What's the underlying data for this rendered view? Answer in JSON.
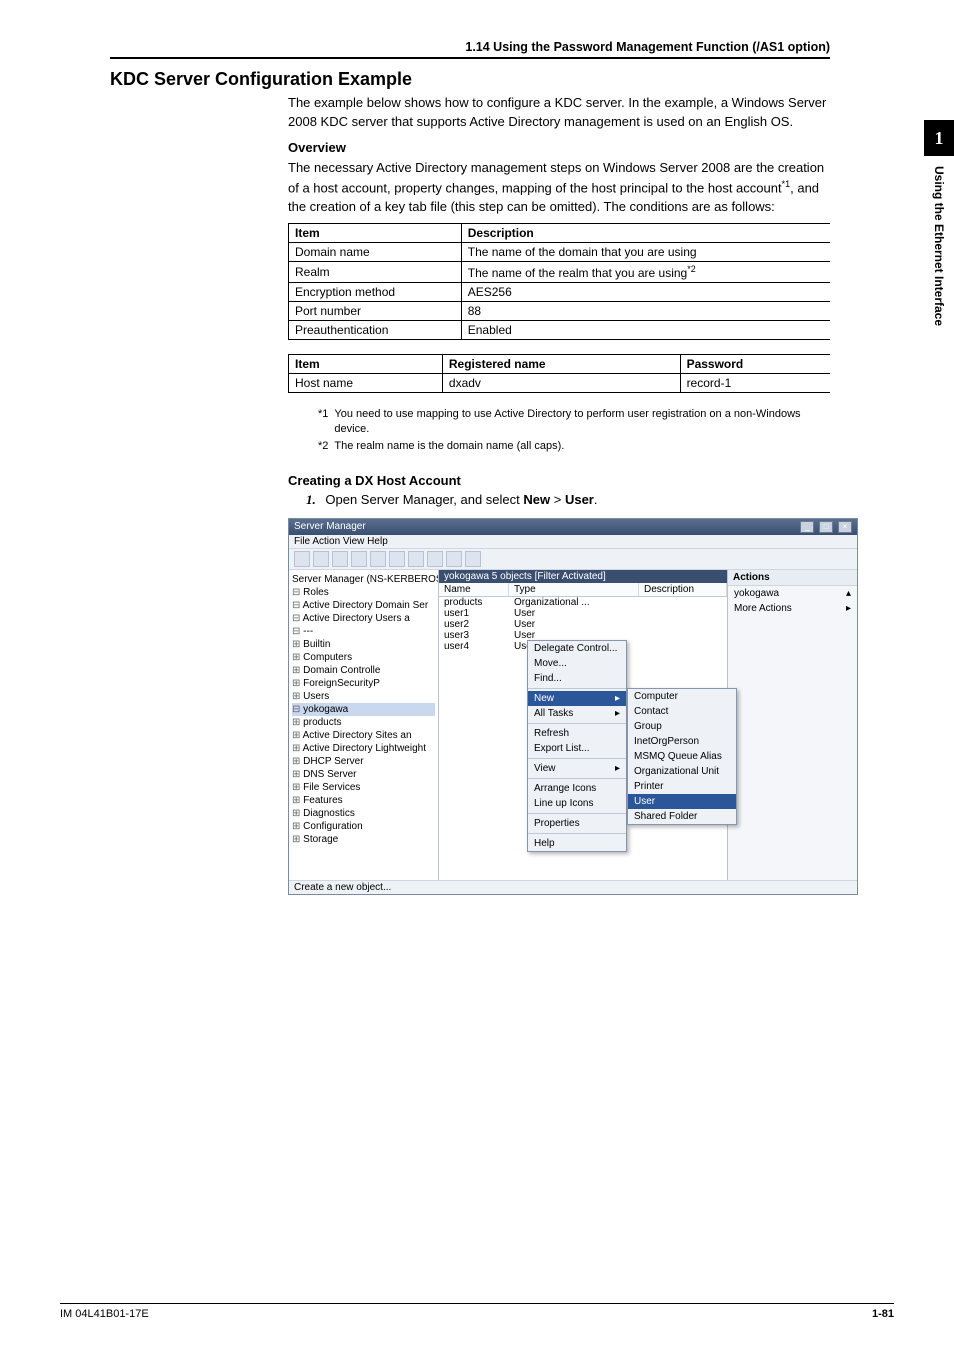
{
  "side": {
    "index": "1",
    "label": "Using the Ethernet Interface"
  },
  "breadcrumb": "1.14  Using the Password Management Function (/AS1 option)",
  "h1": "KDC Server Configuration Example",
  "intro": "The example below shows how to configure a KDC server. In the example, a Windows Server 2008 KDC server that supports Active Directory management is used on an English OS.",
  "overview_h": "Overview",
  "overview_p": "The necessary Active Directory management steps on Windows Server 2008 are the creation of a host account, property changes, mapping of the host principal to the host account",
  "overview_p_tail": ", and the creation of a key tab file (this step can be omitted). The conditions are as follows:",
  "overview_sup": "*1",
  "table1": {
    "head": [
      "Item",
      "Description"
    ],
    "rows": [
      [
        "Domain name",
        "The name of the domain that you are using"
      ],
      [
        "Realm",
        "The name of the realm that you are using"
      ],
      [
        "Encryption method",
        "AES256"
      ],
      [
        "Port number",
        "88"
      ],
      [
        "Preauthentication",
        "Enabled"
      ]
    ],
    "row2_sup": "*2"
  },
  "table2": {
    "head": [
      "Item",
      "Registered name",
      "Password"
    ],
    "rows": [
      [
        "Host name",
        "dxadv",
        "record-1"
      ]
    ]
  },
  "footnotes": [
    {
      "tag": "*1",
      "text": "You need to use mapping to use Active Directory to perform user registration on a non-Windows device."
    },
    {
      "tag": "*2",
      "text": "The realm name is the domain name (all caps)."
    }
  ],
  "create_h": "Creating a DX Host Account",
  "step1_num": "1.",
  "step1_a": "Open Server Manager, and select ",
  "step1_b": "New",
  "step1_c": " > ",
  "step1_d": "User",
  "step1_e": ".",
  "win": {
    "title": "Server Manager",
    "menu": "File   Action   View   Help",
    "root": "Server Manager (NS-KERBEROS)",
    "tree": {
      "roles": "Roles",
      "adds": "Active Directory Domain Ser",
      "adua": "Active Directory Users a",
      "domain": "---",
      "builtin": "Builtin",
      "computers": "Computers",
      "domaincontrollers": "Domain Controlle",
      "foreign": "ForeignSecurityP",
      "users": "Users",
      "yokogawa": "yokogawa",
      "products": "products",
      "adsites": "Active Directory Sites an",
      "adlight": "Active Directory Lightweight",
      "dhcp": "DHCP Server",
      "dns": "DNS Server",
      "filesvc": "File Services",
      "features": "Features",
      "diag": "Diagnostics",
      "config": "Configuration",
      "storage": "Storage"
    },
    "list_header": "yokogawa   5 objects  [Filter Activated]",
    "listcols": {
      "name": "Name",
      "type": "Type",
      "desc": "Description"
    },
    "rows": [
      {
        "name": "products",
        "type": "Organizational ..."
      },
      {
        "name": "user1",
        "type": "User"
      },
      {
        "name": "user2",
        "type": "User"
      },
      {
        "name": "user3",
        "type": "User"
      },
      {
        "name": "user4",
        "type": "User"
      }
    ],
    "ctx": [
      "Delegate Control...",
      "Move...",
      "Find...",
      "New",
      "All Tasks",
      "Refresh",
      "Export List...",
      "View",
      "Arrange Icons",
      "Line up Icons",
      "Properties",
      "Help"
    ],
    "sub": [
      "Computer",
      "Contact",
      "Group",
      "InetOrgPerson",
      "MSMQ Queue Alias",
      "Organizational Unit",
      "Printer",
      "User",
      "Shared Folder"
    ],
    "actions_h": "Actions",
    "actions_sec": "yokogawa",
    "actions_more": "More Actions",
    "status": "Create a new object..."
  },
  "footer": {
    "left": "IM 04L41B01-17E",
    "right": "1-81"
  }
}
